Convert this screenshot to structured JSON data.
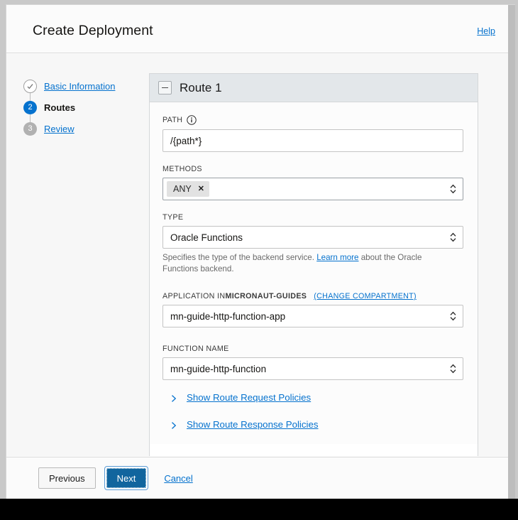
{
  "header": {
    "title": "Create Deployment",
    "help_label": "Help"
  },
  "wizard": {
    "steps": [
      {
        "number": "",
        "label": "Basic Information",
        "state": "done",
        "icon": "check-circle-icon"
      },
      {
        "number": "2",
        "label": "Routes",
        "state": "current",
        "icon": "step-number-icon"
      },
      {
        "number": "3",
        "label": "Review",
        "state": "pending",
        "icon": "step-number-icon"
      }
    ]
  },
  "route_panel": {
    "title": "Route 1",
    "collapse_icon": "minus-square-icon",
    "path": {
      "label": "PATH",
      "info_icon": "info-circle-icon",
      "value": "/{path*}",
      "placeholder": "/{path*}"
    },
    "methods": {
      "label": "METHODS",
      "chips": [
        {
          "label": "ANY",
          "remove_icon": "close-x-icon"
        }
      ],
      "dropdown_icon": "chevron-updown-icon"
    },
    "type": {
      "label": "TYPE",
      "value": "Oracle Functions",
      "dropdown_icon": "chevron-updown-icon",
      "helper_prefix": "Specifies the type of the backend service.",
      "helper_link": "Learn more",
      "helper_suffix": "about the Oracle Functions backend."
    },
    "application": {
      "label_prefix": "APPLICATION IN ",
      "label_compartment": "MICRONAUT-GUIDES",
      "change_compartment_label": "(CHANGE COMPARTMENT)",
      "value": "mn-guide-http-function-app",
      "dropdown_icon": "chevron-updown-icon"
    },
    "function_name": {
      "label": "FUNCTION NAME",
      "value": "mn-guide-http-function",
      "dropdown_icon": "chevron-updown-icon"
    },
    "disclosures": [
      {
        "label": "Show Route Request Policies",
        "icon": "chevron-right-icon"
      },
      {
        "label": "Show Route Response Policies",
        "icon": "chevron-right-icon"
      }
    ]
  },
  "footer": {
    "previous_label": "Previous",
    "next_label": "Next",
    "cancel_label": "Cancel"
  },
  "colors": {
    "accent_blue": "#0572ce",
    "primary_button": "#11659e",
    "panel_header": "#e3e7ea",
    "body_background": "#f7f7f7"
  }
}
